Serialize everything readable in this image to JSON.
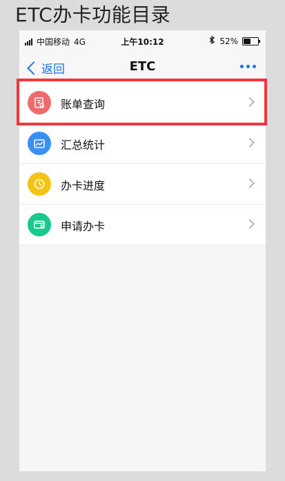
{
  "page": {
    "title": "ETC办卡功能目录"
  },
  "status_bar": {
    "carrier": "中国移动",
    "network": "4G",
    "time": "上午10:12",
    "battery_text": "52%",
    "battery_level": 0.52
  },
  "nav": {
    "back_label": "返回",
    "title": "ETC"
  },
  "items": [
    {
      "label": "账单查询",
      "icon": "bill-query-icon",
      "color": "#ef6b6b",
      "highlighted": true
    },
    {
      "label": "汇总统计",
      "icon": "summary-stats-icon",
      "color": "#3a8ff5",
      "highlighted": false
    },
    {
      "label": "办卡进度",
      "icon": "card-progress-icon",
      "color": "#f3c414",
      "highlighted": false
    },
    {
      "label": "申请办卡",
      "icon": "apply-card-icon",
      "color": "#18c98d",
      "highlighted": false
    }
  ],
  "colors": {
    "accent": "#1a73e8",
    "highlight_border": "#f2353a",
    "background": "#dcdcdc"
  }
}
